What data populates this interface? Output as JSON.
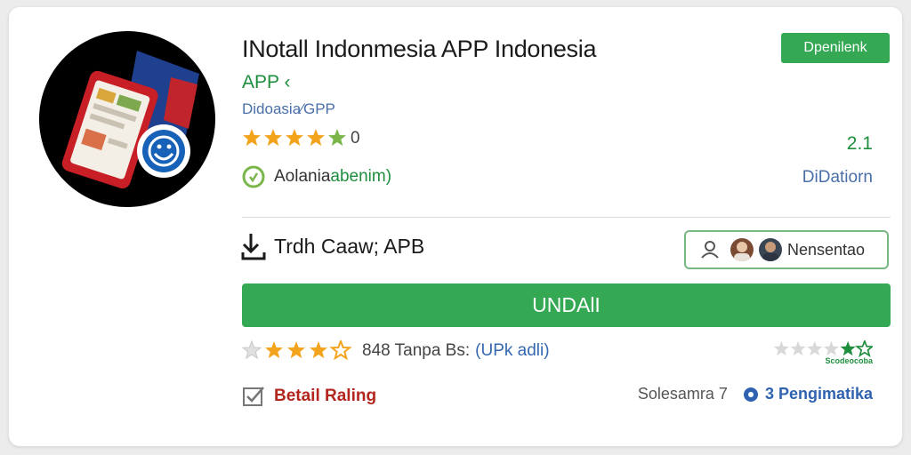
{
  "app": {
    "title": "INotall Indonmesia APP Indonesia",
    "subtitle": "APP ‹",
    "developer": "Didoasia⁄GPP",
    "rating_text": "0",
    "side_number": "2.1",
    "feature_text": "Aolania ",
    "feature_green": "abenim)",
    "side_link": "DiDatiorn"
  },
  "install_button": {
    "label": "Dpenilenk"
  },
  "download": {
    "label": "Trdh Caaw; APB"
  },
  "members": {
    "label": "Nensentao"
  },
  "main_button": {
    "label": "UNDAlI"
  },
  "reviews": {
    "count": "848 Tanpa Bs:",
    "link": "(UPk adli)",
    "mini_caption": "Scodeocoba"
  },
  "detail": {
    "label": "Betail Raling"
  },
  "bottom": {
    "muted": "Solesamra 7",
    "blue": "3 Pengimatika"
  },
  "colors": {
    "accent_green": "#34a853",
    "text_green": "#1e8e3e",
    "star": "#f4a31c",
    "link_blue": "#3468b0",
    "warning_red": "#b3261e"
  }
}
